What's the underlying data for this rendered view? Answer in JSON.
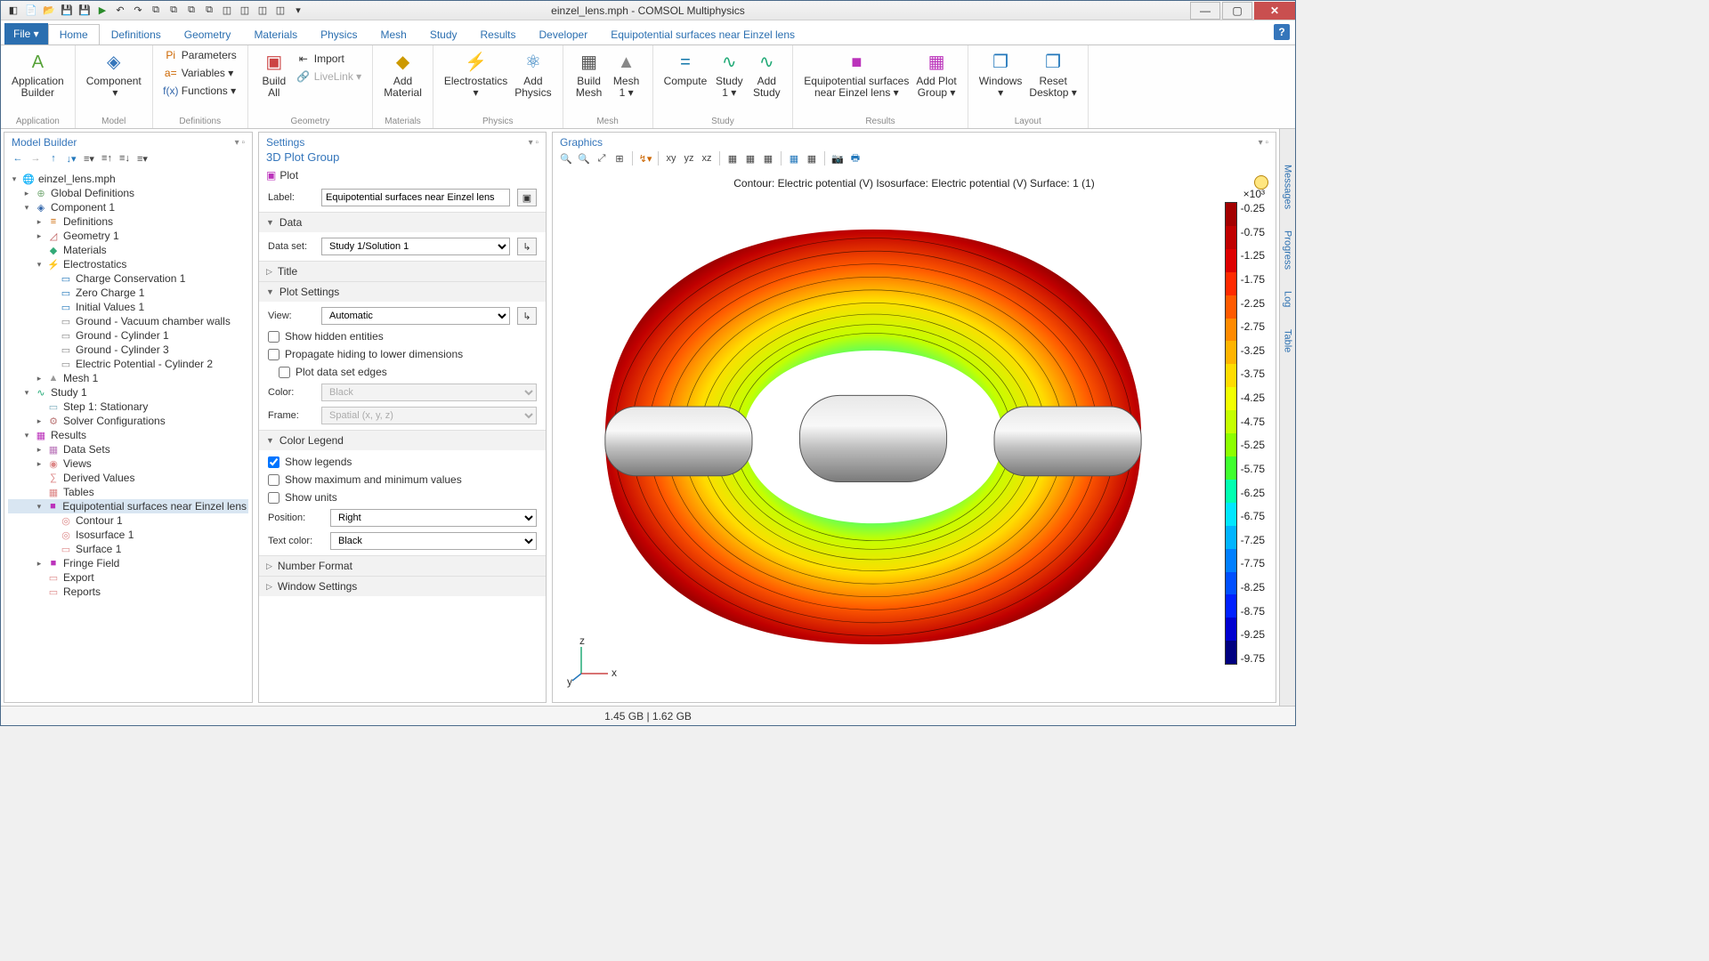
{
  "title": "einzel_lens.mph - COMSOL Multiphysics",
  "menu": {
    "file": "File ▾"
  },
  "tabs": [
    "Home",
    "Definitions",
    "Geometry",
    "Materials",
    "Physics",
    "Mesh",
    "Study",
    "Results",
    "Developer",
    "Equipotential surfaces near Einzel lens"
  ],
  "ribbon": {
    "application": {
      "label": "Application",
      "btn": "Application\nBuilder"
    },
    "model": {
      "label": "Model",
      "btn": "Component\n ▾"
    },
    "definitions": {
      "label": "Definitions",
      "params": "Parameters",
      "vars": "Variables ▾",
      "funcs": "Functions ▾"
    },
    "geometry": {
      "label": "Geometry",
      "build": "Build\nAll",
      "import": "Import",
      "livelink": "LiveLink ▾"
    },
    "materials": {
      "label": "Materials",
      "add": "Add\nMaterial"
    },
    "physics": {
      "label": "Physics",
      "es": "Electrostatics\n▾",
      "add": "Add\nPhysics"
    },
    "mesh": {
      "label": "Mesh",
      "build": "Build\nMesh",
      "mesh1": "Mesh\n1 ▾"
    },
    "study": {
      "label": "Study",
      "compute": "Compute",
      "study1": "Study\n1 ▾",
      "add": "Add\nStudy"
    },
    "results": {
      "label": "Results",
      "plot": "Equipotential surfaces\nnear Einzel lens ▾",
      "addgrp": "Add Plot\nGroup ▾"
    },
    "layout": {
      "label": "Layout",
      "windows": "Windows\n▾",
      "reset": "Reset\nDesktop ▾"
    }
  },
  "mb": {
    "title": "Model Builder",
    "tree": [
      {
        "d": 0,
        "exp": "▾",
        "ico": "🌐",
        "txt": "einzel_lens.mph",
        "c": "#368"
      },
      {
        "d": 1,
        "exp": "▸",
        "ico": "⊕",
        "txt": "Global Definitions",
        "c": "#7a7"
      },
      {
        "d": 1,
        "exp": "▾",
        "ico": "◈",
        "txt": "Component 1",
        "c": "#36a"
      },
      {
        "d": 2,
        "exp": "▸",
        "ico": "≡",
        "txt": "Definitions",
        "c": "#c60"
      },
      {
        "d": 2,
        "exp": "▸",
        "ico": "◿",
        "txt": "Geometry 1",
        "c": "#b55"
      },
      {
        "d": 2,
        "exp": "",
        "ico": "◆",
        "txt": "Materials",
        "c": "#3a7"
      },
      {
        "d": 2,
        "exp": "▾",
        "ico": "⚡",
        "txt": "Electrostatics",
        "c": "#c60"
      },
      {
        "d": 3,
        "exp": "",
        "ico": "▭",
        "txt": "Charge Conservation 1",
        "c": "#27b"
      },
      {
        "d": 3,
        "exp": "",
        "ico": "▭",
        "txt": "Zero Charge 1",
        "c": "#27b"
      },
      {
        "d": 3,
        "exp": "",
        "ico": "▭",
        "txt": "Initial Values 1",
        "c": "#27b"
      },
      {
        "d": 3,
        "exp": "",
        "ico": "▭",
        "txt": "Ground - Vacuum chamber walls",
        "c": "#888"
      },
      {
        "d": 3,
        "exp": "",
        "ico": "▭",
        "txt": "Ground - Cylinder 1",
        "c": "#888"
      },
      {
        "d": 3,
        "exp": "",
        "ico": "▭",
        "txt": "Ground - Cylinder 3",
        "c": "#888"
      },
      {
        "d": 3,
        "exp": "",
        "ico": "▭",
        "txt": "Electric Potential - Cylinder 2",
        "c": "#888"
      },
      {
        "d": 2,
        "exp": "▸",
        "ico": "▲",
        "txt": "Mesh 1",
        "c": "#999"
      },
      {
        "d": 1,
        "exp": "▾",
        "ico": "∿",
        "txt": "Study 1",
        "c": "#2a7"
      },
      {
        "d": 2,
        "exp": "",
        "ico": "▭",
        "txt": "Step 1: Stationary",
        "c": "#7ab"
      },
      {
        "d": 2,
        "exp": "▸",
        "ico": "⚙",
        "txt": "Solver Configurations",
        "c": "#b77"
      },
      {
        "d": 1,
        "exp": "▾",
        "ico": "▦",
        "txt": "Results",
        "c": "#b3b"
      },
      {
        "d": 2,
        "exp": "▸",
        "ico": "▦",
        "txt": "Data Sets",
        "c": "#b7b"
      },
      {
        "d": 2,
        "exp": "▸",
        "ico": "◉",
        "txt": "Views",
        "c": "#d88"
      },
      {
        "d": 2,
        "exp": "",
        "ico": "∑",
        "txt": "Derived Values",
        "c": "#d88"
      },
      {
        "d": 2,
        "exp": "",
        "ico": "▦",
        "txt": "Tables",
        "c": "#d88"
      },
      {
        "d": 2,
        "exp": "▾",
        "ico": "■",
        "txt": "Equipotential surfaces near Einzel lens",
        "c": "#b3b",
        "sel": true
      },
      {
        "d": 3,
        "exp": "",
        "ico": "◎",
        "txt": "Contour 1",
        "c": "#d88"
      },
      {
        "d": 3,
        "exp": "",
        "ico": "◎",
        "txt": "Isosurface 1",
        "c": "#d88"
      },
      {
        "d": 3,
        "exp": "",
        "ico": "▭",
        "txt": "Surface 1",
        "c": "#d88"
      },
      {
        "d": 2,
        "exp": "▸",
        "ico": "■",
        "txt": "Fringe Field",
        "c": "#b3b"
      },
      {
        "d": 2,
        "exp": "",
        "ico": "▭",
        "txt": "Export",
        "c": "#d88"
      },
      {
        "d": 2,
        "exp": "",
        "ico": "▭",
        "txt": "Reports",
        "c": "#d88"
      }
    ]
  },
  "settings": {
    "title": "Settings",
    "subtitle": "3D Plot Group",
    "plot": "Plot",
    "label_lbl": "Label:",
    "label_val": "Equipotential surfaces near Einzel lens",
    "sections": {
      "data": "Data",
      "dataset_lbl": "Data set:",
      "dataset_val": "Study 1/Solution 1",
      "title": "Title",
      "plotset": "Plot Settings",
      "view_lbl": "View:",
      "view_val": "Automatic",
      "show_hidden": "Show hidden entities",
      "propagate": "Propagate hiding to lower dimensions",
      "plot_edges": "Plot data set edges",
      "color_lbl": "Color:",
      "color_val": "Black",
      "frame_lbl": "Frame:",
      "frame_val": "Spatial  (x, y, z)",
      "colorlegend": "Color Legend",
      "show_legends": "Show legends",
      "show_minmax": "Show maximum and minimum values",
      "show_units": "Show units",
      "pos_lbl": "Position:",
      "pos_val": "Right",
      "textcolor_lbl": "Text color:",
      "textcolor_val": "Black",
      "numfmt": "Number Format",
      "winset": "Window Settings"
    }
  },
  "graphics": {
    "title": "Graphics",
    "plot_title": "Contour: Electric potential (V)  Isosurface: Electric potential (V)  Surface: 1 (1)",
    "axis": {
      "x": "x",
      "y": "y",
      "z": "z"
    },
    "legend": {
      "mult": "×10³",
      "ticks": [
        "-0.25",
        "-0.75",
        "-1.25",
        "-1.75",
        "-2.25",
        "-2.75",
        "-3.25",
        "-3.75",
        "-4.25",
        "-4.75",
        "-5.25",
        "-5.75",
        "-6.25",
        "-6.75",
        "-7.25",
        "-7.75",
        "-8.25",
        "-8.75",
        "-9.25",
        "-9.75"
      ],
      "colors": [
        "#a30000",
        "#c00000",
        "#dd0000",
        "#ff2a00",
        "#ff5a00",
        "#ff8a00",
        "#ffb400",
        "#ffdc00",
        "#f2ff00",
        "#c4ff00",
        "#8cff00",
        "#3fff2e",
        "#00ffb0",
        "#00e6ff",
        "#00b4ff",
        "#007fff",
        "#004fff",
        "#0020ff",
        "#0000d0",
        "#000080"
      ]
    }
  },
  "side": [
    "Messages",
    "Progress",
    "Log",
    "Table"
  ],
  "status": "1.45 GB | 1.62 GB"
}
